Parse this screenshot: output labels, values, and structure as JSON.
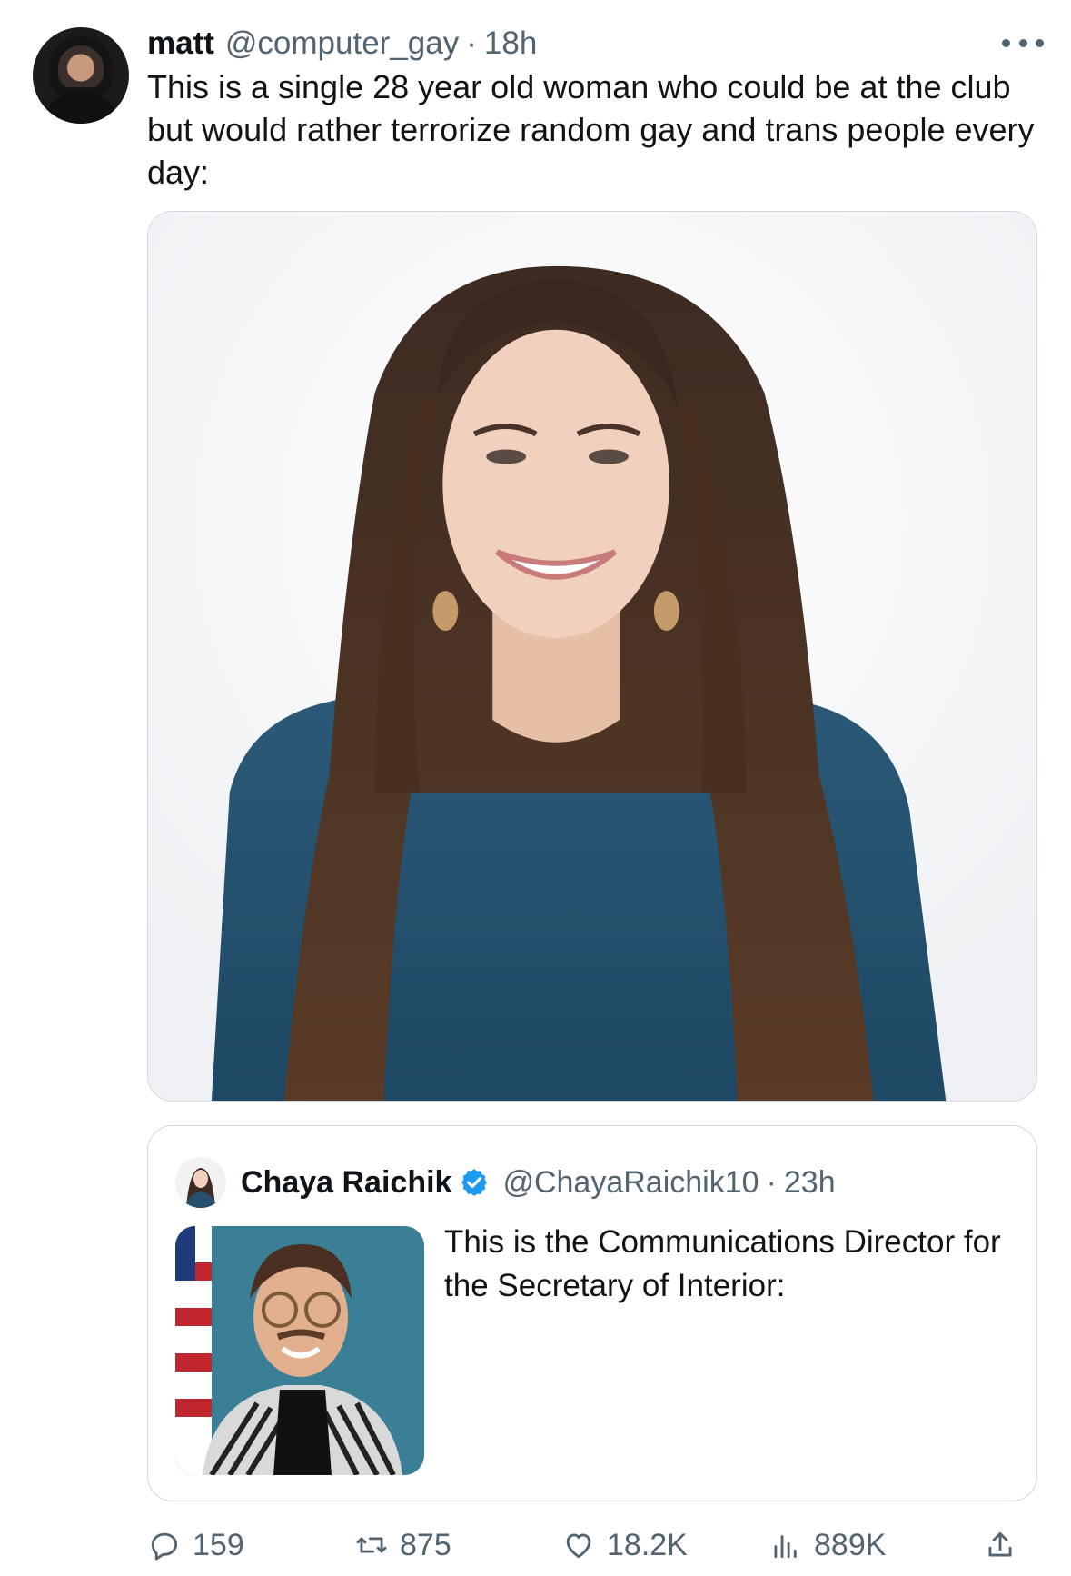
{
  "tweet": {
    "author_name": "matt",
    "author_handle": "@computer_gay",
    "separator": "·",
    "timestamp": "18h",
    "text": "This is a single 28 year old woman who could be at the club but would rather terrorize random gay and trans people every day:",
    "icons": {
      "avatar": "avatar",
      "more": "more-options-icon"
    }
  },
  "quote": {
    "author_name": "Chaya Raichik",
    "verified": true,
    "author_handle": "@ChayaRaichik10",
    "separator": "·",
    "timestamp": "23h",
    "text": "This is the Communications Director for the Secretary of Interior:"
  },
  "actions": {
    "reply_count": "159",
    "retweet_count": "875",
    "like_count": "18.2K",
    "views_count": "889K",
    "icons": [
      "reply-icon",
      "retweet-icon",
      "like-icon",
      "views-icon",
      "share-icon"
    ]
  },
  "colors": {
    "text_primary": "#0f1419",
    "text_secondary": "#536471",
    "border": "#cfd9de",
    "verified_blue": "#1d9bf0"
  }
}
